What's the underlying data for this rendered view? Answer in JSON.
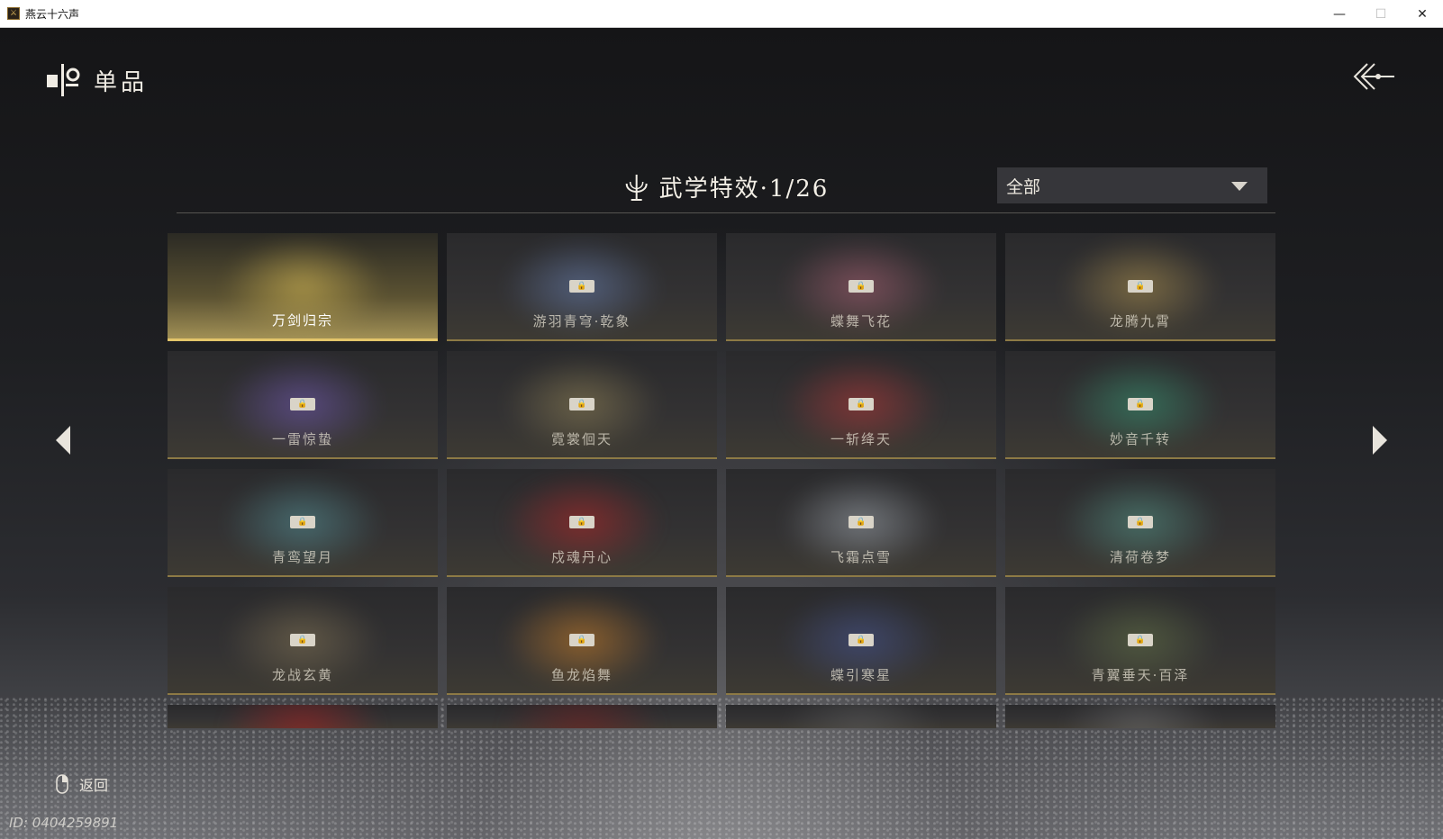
{
  "window": {
    "title": "燕云十六声",
    "minimize": "—",
    "maximize": "☐",
    "close": "✕"
  },
  "header": {
    "title": "单品"
  },
  "section": {
    "title": "武学特效·1/26"
  },
  "filter": {
    "selected": "全部"
  },
  "cards": [
    {
      "label": "万剑归宗",
      "unlocked": true,
      "color": "#e8c95a"
    },
    {
      "label": "游羽青穹·乾象",
      "unlocked": false,
      "color": "#6e86b8"
    },
    {
      "label": "蝶舞飞花",
      "unlocked": false,
      "color": "#b5667a"
    },
    {
      "label": "龙腾九霄",
      "unlocked": false,
      "color": "#b89a52"
    },
    {
      "label": "一雷惊蛰",
      "unlocked": false,
      "color": "#7a5fc0"
    },
    {
      "label": "霓裳佪天",
      "unlocked": false,
      "color": "#9a8a5a"
    },
    {
      "label": "一斩绛天",
      "unlocked": false,
      "color": "#c03a3a"
    },
    {
      "label": "妙音千转",
      "unlocked": false,
      "color": "#3aa07a"
    },
    {
      "label": "青鸾望月",
      "unlocked": false,
      "color": "#5a9aa0"
    },
    {
      "label": "戍魂丹心",
      "unlocked": false,
      "color": "#c02828"
    },
    {
      "label": "飞霜点雪",
      "unlocked": false,
      "color": "#a8b0b8"
    },
    {
      "label": "清荷卷梦",
      "unlocked": false,
      "color": "#5aa090"
    },
    {
      "label": "龙战玄黄",
      "unlocked": false,
      "color": "#8a7a58"
    },
    {
      "label": "鱼龙焰舞",
      "unlocked": false,
      "color": "#d8882a"
    },
    {
      "label": "蝶引寒星",
      "unlocked": false,
      "color": "#4a5a9a"
    },
    {
      "label": "青翼垂天·百泽",
      "unlocked": false,
      "color": "#6a7a4a"
    }
  ],
  "partial_cards": [
    {
      "color": "#b02020"
    },
    {
      "color": "#7a2020"
    },
    {
      "color": "#606060"
    },
    {
      "color": "#707070"
    }
  ],
  "footer": {
    "back_label": "返回",
    "uid": "ID: 0404259891"
  }
}
